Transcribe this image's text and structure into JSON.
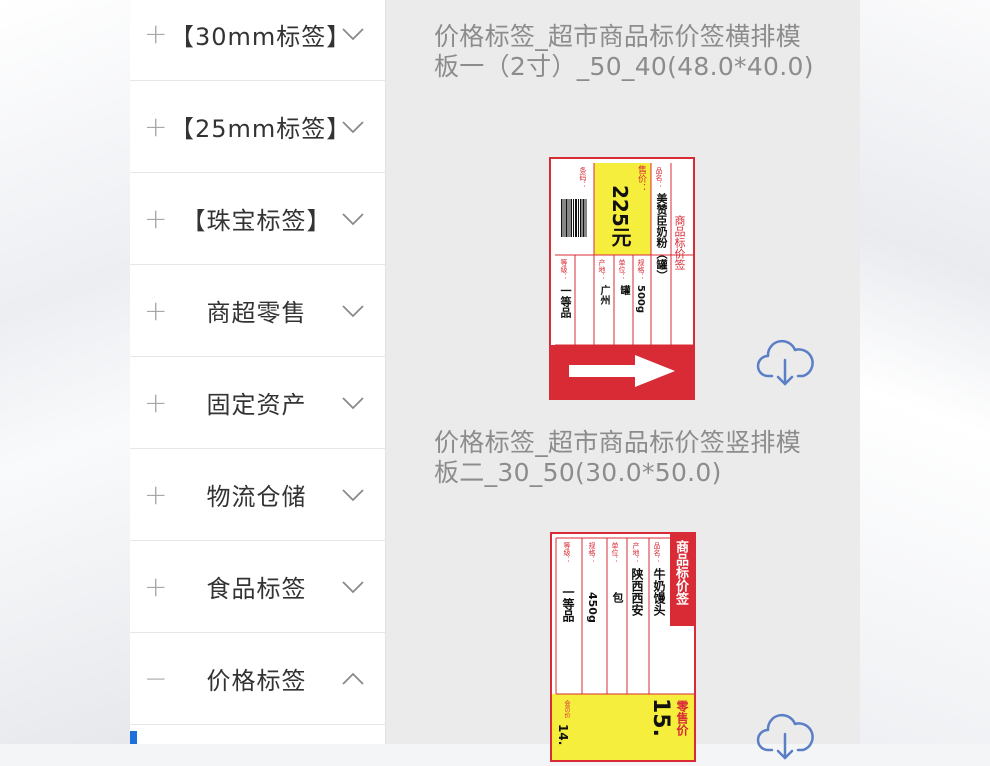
{
  "sidebar": {
    "categories": [
      {
        "label": "【30mm标签】",
        "expanded": false
      },
      {
        "label": "【25mm标签】",
        "expanded": false
      },
      {
        "label": "【珠宝标签】",
        "expanded": false
      },
      {
        "label": "商超零售",
        "expanded": false
      },
      {
        "label": "固定资产",
        "expanded": false
      },
      {
        "label": "物流仓储",
        "expanded": false
      },
      {
        "label": "食品标签",
        "expanded": false
      },
      {
        "label": "价格标签",
        "expanded": true
      }
    ],
    "plus_glyph": "+",
    "minus_glyph": "−"
  },
  "templates": [
    {
      "title": "价格标签_超市商品标价签横排模板一（2寸）_50_40(48.0*40.0)",
      "label": {
        "header": "商品标价签",
        "name_key": "品名：",
        "name_val": "美赞臣奶粉（罐）",
        "price_key": "售价：",
        "price_val": "225元",
        "spec_key": "规格：",
        "spec_val": "500g",
        "unit_key": "单位：",
        "unit_val": "罐",
        "origin_key": "产地：",
        "origin_val": "广州",
        "grade_key": "等级：",
        "grade_val": "一等品",
        "barcode_key": "条码："
      }
    },
    {
      "title": "价格标签_超市商品标价签竖排模板二_30_50(30.0*50.0)",
      "label": {
        "header": "商品标价签",
        "name_key": "品名：",
        "name_val": "牛奶馒头",
        "origin_key": "产地：",
        "origin_val": "陕西西安",
        "unit_key": "单位：",
        "unit_val": "包",
        "spec_key": "规格：",
        "spec_val": "450g",
        "grade_key": "等级：",
        "grade_val": "一等品",
        "retail_key": "零售价",
        "retail_val": "15.",
        "member_key": "会员价",
        "member_val": "14."
      }
    }
  ],
  "colors": {
    "accent_blue": "#1e6fd9",
    "label_red": "#d82b35",
    "label_yellow": "#f6ee3c",
    "cloud_blue": "#5b7fc6"
  },
  "icons": {
    "expand": "plus-icon",
    "collapse": "minus-icon",
    "chevron_down": "chevron-down-icon",
    "chevron_up": "chevron-up-icon",
    "download": "cloud-download-icon"
  }
}
